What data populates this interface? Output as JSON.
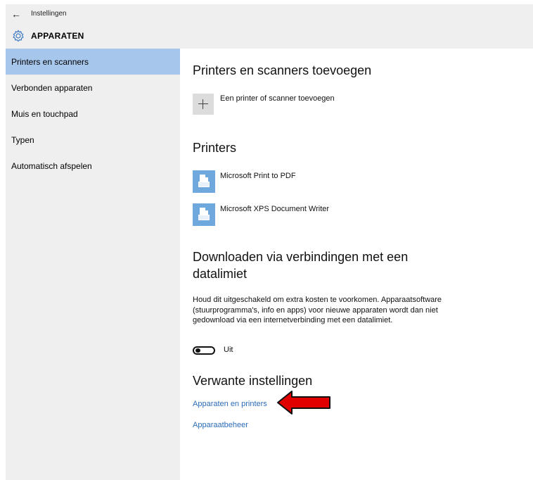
{
  "window": {
    "app_title": "Instellingen",
    "back_icon": "back-arrow-icon",
    "section_icon": "gear-icon",
    "section_title": "APPARATEN"
  },
  "sidebar": {
    "items": [
      {
        "label": "Printers en scanners",
        "selected": true
      },
      {
        "label": "Verbonden apparaten",
        "selected": false
      },
      {
        "label": "Muis en touchpad",
        "selected": false
      },
      {
        "label": "Typen",
        "selected": false
      },
      {
        "label": "Automatisch afspelen",
        "selected": false
      }
    ]
  },
  "content": {
    "add_heading": "Printers en scanners toevoegen",
    "add_label": "Een printer of scanner toevoegen",
    "printers_heading": "Printers",
    "printers": [
      {
        "name": "Microsoft Print to PDF",
        "icon": "printer-icon"
      },
      {
        "name": "Microsoft XPS Document Writer",
        "icon": "printer-icon"
      }
    ],
    "metered_heading_line1": "Downloaden via verbindingen met een",
    "metered_heading_line2": "datalimiet",
    "metered_description": "Houd dit uitgeschakeld om extra kosten te voorkomen. Apparaatsoftware (stuurprogramma's, info en apps) voor nieuwe apparaten wordt dan niet gedownload via een internetverbinding met een datalimiet.",
    "metered_toggle_state": "Uit",
    "metered_toggle_on": false,
    "related_heading": "Verwante instellingen",
    "links": [
      {
        "label": "Apparaten en printers"
      },
      {
        "label": "Apparaatbeheer"
      }
    ]
  },
  "colors": {
    "accent_selected": "#a6c6eb",
    "link": "#2b6cb8",
    "printer_icon": "#6fa8dc",
    "annotation_arrow": "#e00000"
  },
  "annotation": {
    "icon": "red-arrow-icon",
    "points_to": "Apparaten en printers"
  }
}
